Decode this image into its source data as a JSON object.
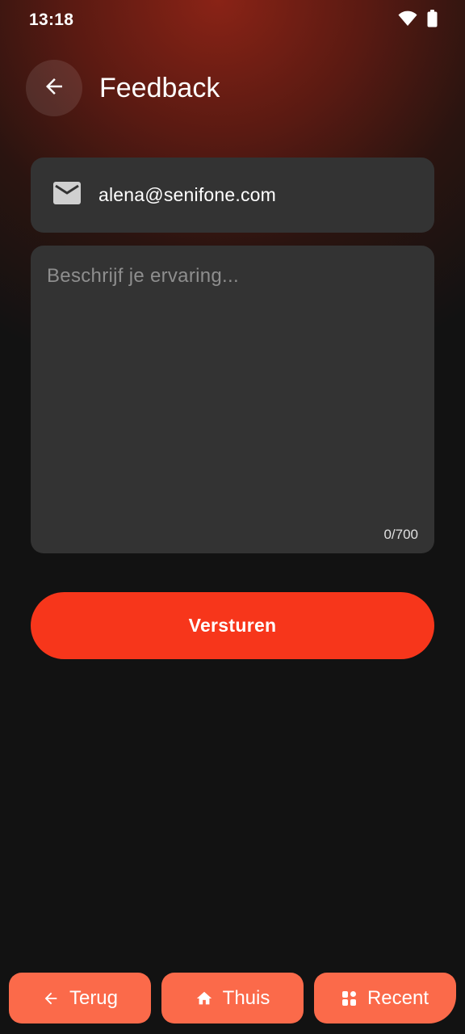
{
  "status_bar": {
    "time": "13:18",
    "icons": [
      "wifi-icon",
      "battery-icon"
    ]
  },
  "header": {
    "back_icon": "arrow-left-icon",
    "title": "Feedback"
  },
  "form": {
    "email_icon": "mail-icon",
    "email_value": "alena@senifone.com",
    "message_placeholder": "Beschrijf je ervaring...",
    "message_value": "",
    "char_counter": "0/700",
    "submit_label": "Versturen"
  },
  "bottom_nav": {
    "items": [
      {
        "label": "Terug",
        "icon": "arrow-left-icon"
      },
      {
        "label": "Thuis",
        "icon": "home-icon"
      },
      {
        "label": "Recent",
        "icon": "grid-icon"
      }
    ]
  },
  "colors": {
    "background": "#121212",
    "field_background": "#333333",
    "accent": "#f7361b",
    "nav_button": "#fb6a4a",
    "header_glow": "#8a2316"
  }
}
